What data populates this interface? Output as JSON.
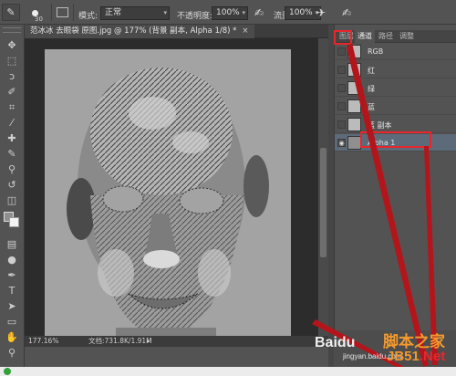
{
  "options_bar": {
    "brush_size": "30",
    "mode_label": "模式:",
    "mode_value": "正常",
    "opacity_label": "不透明度:",
    "opacity_value": "100%",
    "flow_label": "流量:",
    "flow_value": "100%"
  },
  "document": {
    "tab_title": "范冰冰 去眼袋 原图.jpg @ 177% (背景 副本, Alpha 1/8) *",
    "zoom": "177.16%",
    "doc_size": "文档:731.8K/1.91M"
  },
  "panel": {
    "tabs": [
      "图层",
      "通道",
      "路径",
      "调整"
    ],
    "active_tab": "通道",
    "channels": [
      {
        "name": "RGB",
        "selected": false
      },
      {
        "name": "红",
        "selected": false
      },
      {
        "name": "绿",
        "selected": false
      },
      {
        "name": "蓝",
        "selected": false
      },
      {
        "name": "蓝 副本",
        "selected": false
      },
      {
        "name": "Alpha 1",
        "selected": true
      }
    ]
  },
  "watermarks": {
    "baidu": "Baidu",
    "jingyan": "jingyan.baidu.com",
    "site_cn": "脚本之家",
    "site_en_prefix": "JB51",
    "site_en_suffix": ".Net"
  },
  "colors": {
    "ui_bg": "#535353",
    "highlight_red": "#e8262d",
    "selected_row": "#5d6a7a"
  }
}
